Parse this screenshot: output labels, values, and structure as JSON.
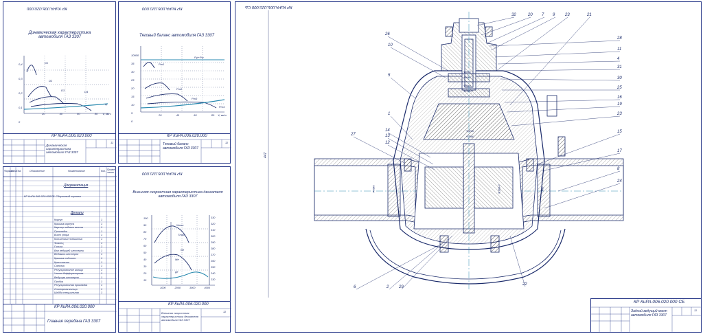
{
  "sheets": {
    "dynamic": {
      "title": "Динамическая характеристика автомобиля ГАЗ 3307",
      "code": "КР КиРА.006.020.000",
      "corner_code": "КР КиРА.006.020.000",
      "ylabels": [
        "0,4",
        "0,3",
        "0,2",
        "0,1",
        "0"
      ],
      "xlabels": [
        "20",
        "40",
        "60",
        "80",
        "V, км/ч"
      ],
      "curve_labels": [
        "D1",
        "D2",
        "D3",
        "D4",
        "ψ"
      ],
      "stamp_title": "Динамическая характеристика автомобиля ГАЗ 3307",
      "sheet_num": "11"
    },
    "traction": {
      "title": "Тяговый баланс автомобиля ГАЗ 3307",
      "code": "КР КиРА.006.020.000",
      "corner_code": "КР КиРА.006.020.000",
      "ylabels": [
        "10000",
        "35",
        "30",
        "25",
        "20",
        "15",
        "10",
        "5",
        "0"
      ],
      "xlabels": [
        "20",
        "40",
        "60",
        "80",
        "V, км/ч"
      ],
      "curve_labels": [
        "Pт1",
        "Pт2",
        "Pт3",
        "Pт4",
        "Pψ+Pw"
      ],
      "stamp_title": "Тяговый баланс автомобиля ГАЗ 3307",
      "sheet_num": "11"
    },
    "spec": {
      "header": [
        "Формат",
        "Зона",
        "Поз.",
        "Обозначение",
        "Наименование",
        "Кол.",
        "Приме- чание"
      ],
      "section1": "Документация",
      "doc_row": {
        "code": "КР КиРА.006.020.000СБ",
        "name": "Сборочный чертеж"
      },
      "section2": "Детали",
      "items": [
        "Корпус",
        "Крышка корпуса",
        "Картер заднего моста",
        "Прокладка",
        "Винт упора",
        "Конический подшипник",
        "Фланец",
        "Гильза",
        "Вал ведущей шестерни",
        "Ведомая шестерня",
        "Крышка подшипн.",
        "Крестовина",
        "Сальник",
        "Регулировочное кольцо",
        "Чашка дифференциала",
        "Ведущая шестерня",
        "Пробка",
        "Регулировочная прокладка",
        "Стопорная кольцо",
        "Шайба специальная"
      ],
      "code": "КР КиРА.006.020.000",
      "stamp_title": "Главная передача ГАЗ 3307"
    },
    "speed": {
      "title": "Внешняя скоростная характеристика двигателя автомобиля ГАЗ 3307",
      "code": "КР КиРА.006.020.000",
      "corner_code": "КР КиРА.006.020.000",
      "ylabels_left": [
        "100",
        "90",
        "80",
        "70",
        "60",
        "50",
        "40",
        "30",
        "20",
        "10"
      ],
      "ylabels_right": [
        "330",
        "320",
        "310",
        "300",
        "290",
        "280",
        "270",
        "260",
        "250",
        "240",
        "230"
      ],
      "xlabels": [
        "1000",
        "2000",
        "3000",
        "4000"
      ],
      "curve_labels": [
        "Nmax",
        "Tmax",
        "Nе",
        "Mе",
        "gе"
      ],
      "stamp_title": "Внешняя скоростная характеристика двигателя автомобиля ГАЗ 3307",
      "sheet_num": "11"
    },
    "main": {
      "corner_code": "КР КиРА.006.020.000 СБ",
      "code": "КР КиРА.006.020.000 СБ",
      "stamp_title": "Задний ведущий мост автомобиля ГАЗ 3307",
      "sheet_num": "11",
      "dim_label": "447",
      "callouts_top": [
        "32",
        "20",
        "7",
        "9",
        "23",
        "21"
      ],
      "callouts_left": [
        "26",
        "10",
        "5",
        "1",
        "27",
        "14",
        "13",
        "12",
        "6",
        "2",
        "29"
      ],
      "callouts_right": [
        "28",
        "11",
        "4",
        "31",
        "30",
        "25",
        "16",
        "19",
        "23",
        "15",
        "17",
        "8",
        "24",
        "22"
      ],
      "dims": [
        "Ф65k6",
        "Ф90Н7",
        "Ф65k6",
        "Ф150Н7",
        "Ф42h6",
        "Ф75k6",
        "Ф55k6",
        "Ф100Н7",
        "Ф86"
      ]
    }
  },
  "colors": {
    "line": "#1a2a6a",
    "accent": "#2a8ab0",
    "hatch": "#444444"
  }
}
